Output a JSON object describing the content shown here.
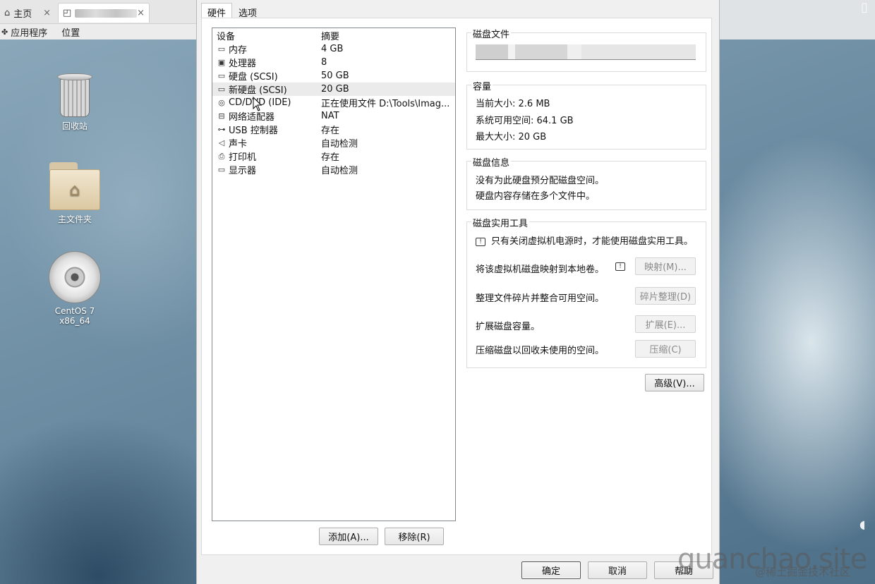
{
  "browser": {
    "home_tab_label": "主页",
    "close_glyph": "×"
  },
  "top_menu": {
    "applications": "应用程序",
    "places": "位置"
  },
  "desktop": {
    "icons": [
      {
        "label": "回收站",
        "icon": "trash-icon"
      },
      {
        "label": "主文件夹",
        "icon": "home-folder-icon"
      },
      {
        "label": "CentOS 7 x86_64",
        "icon": "disc-icon"
      }
    ]
  },
  "dialog": {
    "tabs": [
      "硬件",
      "选项"
    ],
    "device_list": {
      "headers": [
        "设备",
        "摘要"
      ],
      "rows": [
        {
          "icon": "memory-icon",
          "device": "内存",
          "summary": "4 GB"
        },
        {
          "icon": "cpu-icon",
          "device": "处理器",
          "summary": "8"
        },
        {
          "icon": "hdd-icon",
          "device": "硬盘 (SCSI)",
          "summary": "50 GB"
        },
        {
          "icon": "hdd-icon",
          "device": "新硬盘 (SCSI)",
          "summary": "20 GB",
          "selected": true
        },
        {
          "icon": "cdrom-icon",
          "device": "CD/DVD (IDE)",
          "summary": "正在使用文件 D:\\Tools\\Imag..."
        },
        {
          "icon": "network-icon",
          "device": "网络适配器",
          "summary": "NAT"
        },
        {
          "icon": "usb-icon",
          "device": "USB 控制器",
          "summary": "存在"
        },
        {
          "icon": "sound-icon",
          "device": "声卡",
          "summary": "自动检测"
        },
        {
          "icon": "printer-icon",
          "device": "打印机",
          "summary": "存在"
        },
        {
          "icon": "display-icon",
          "device": "显示器",
          "summary": "自动检测"
        }
      ]
    },
    "add_button": "添加(A)...",
    "remove_button": "移除(R)",
    "disk_file": {
      "title": "磁盘文件"
    },
    "capacity": {
      "title": "容量",
      "current": "当前大小: 2.6 MB",
      "available": "系统可用空间: 64.1 GB",
      "max": "最大大小: 20 GB"
    },
    "disk_info": {
      "title": "磁盘信息",
      "line1": "没有为此硬盘预分配磁盘空间。",
      "line2": "硬盘内容存储在多个文件中。"
    },
    "disk_tools": {
      "title": "磁盘实用工具",
      "notice": "只有关闭虚拟机电源时，才能使用磁盘实用工具。",
      "map_text": "将该虚拟机磁盘映射到本地卷。",
      "map_button": "映射(M)...",
      "defrag_text": "整理文件碎片并整合可用空间。",
      "defrag_button": "碎片整理(D)",
      "expand_text": "扩展磁盘容量。",
      "expand_button": "扩展(E)...",
      "compact_text": "压缩磁盘以回收未使用的空间。",
      "compact_button": "压缩(C)"
    },
    "advanced_button": "高级(V)...",
    "ok_button": "确定",
    "cancel_button": "取消",
    "help_button": "帮助"
  },
  "watermark": {
    "site": "guanchao.site",
    "community": "@稀土掘金技术社区"
  }
}
